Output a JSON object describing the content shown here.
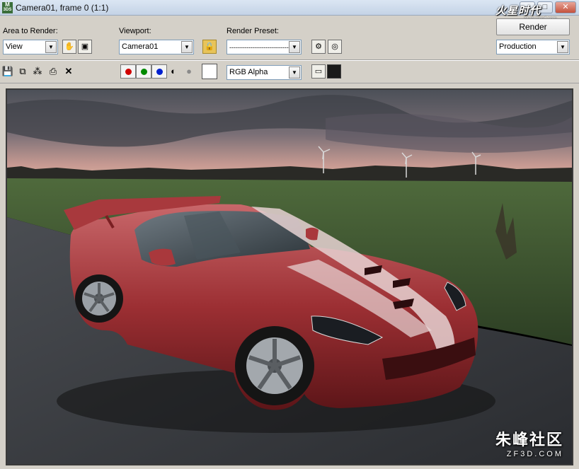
{
  "window": {
    "title": "Camera01, frame 0 (1:1)",
    "icon_text": "M",
    "icon_sub": "3DS",
    "watermark_top": "火星时代",
    "watermark_top_url": "www.hxsd.com"
  },
  "toolbar": {
    "area_label": "Area to Render:",
    "area_value": "View",
    "viewport_label": "Viewport:",
    "viewport_value": "Camera01",
    "preset_label": "Render Preset:",
    "preset_value": "-----------------------------",
    "render_button": "Render",
    "mode_value": "Production",
    "channel_value": "RGB Alpha"
  },
  "icons": {
    "save": "save-icon",
    "copy": "copy-icon",
    "clone": "clone-window-icon",
    "print": "print-icon",
    "clear": "clear-icon"
  },
  "channels": {
    "red": "#d00000",
    "green": "#008a00",
    "blue": "#0020d0"
  },
  "watermark": {
    "brand": "朱峰社区",
    "site": "ZF3D.COM"
  }
}
